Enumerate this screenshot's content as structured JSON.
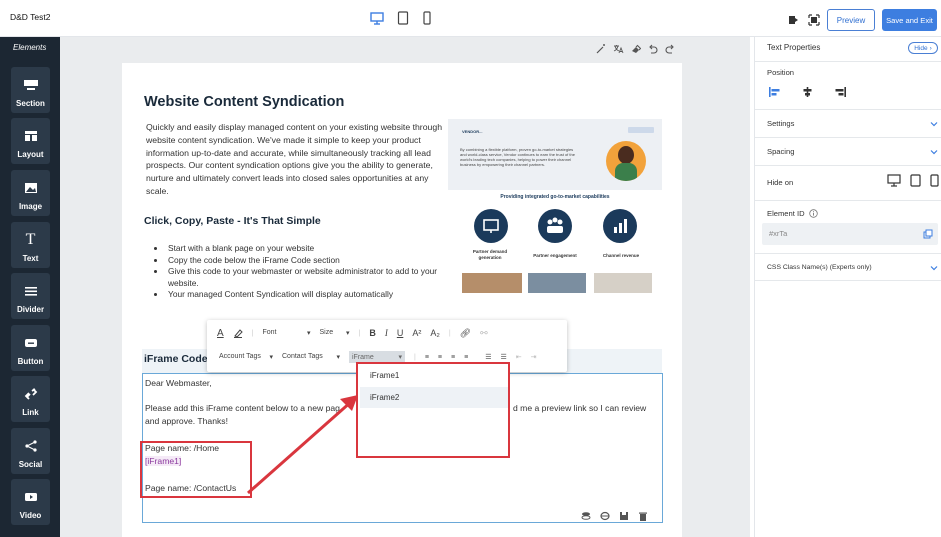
{
  "app": {
    "title": "D&D Test2",
    "preview_label": "Preview",
    "save_label": "Save and Exit"
  },
  "elements_panel": {
    "heading": "Elements",
    "items": [
      {
        "label": "Section",
        "icon": "section-icon"
      },
      {
        "label": "Layout",
        "icon": "layout-icon"
      },
      {
        "label": "Image",
        "icon": "image-icon"
      },
      {
        "label": "Text",
        "icon": "text-icon"
      },
      {
        "label": "Divider",
        "icon": "divider-icon"
      },
      {
        "label": "Button",
        "icon": "button-icon"
      },
      {
        "label": "Link",
        "icon": "link-icon"
      },
      {
        "label": "Social",
        "icon": "share-icon"
      },
      {
        "label": "Video",
        "icon": "video-icon"
      }
    ]
  },
  "content": {
    "heading": "Website Content Syndication",
    "paragraph": "Quickly and easily display managed content on your existing website through website content syndication. We've made it simple to keep your product information up-to-date and accurate, while simultaneously tracking all lead prospects. Our content syndication options give you the ability to generate, nurture and ultimately convert leads into closed sales opportunities at any scale.",
    "subheading": "Click, Copy, Paste - It's That Simple",
    "bullets": [
      "Start with a blank page on your website",
      "Copy the code below the iFrame Code section",
      "Give this code to your webmaster or website administrator to add to your website.",
      "Your managed Content Syndication will display automatically"
    ],
    "iframe_heading": "iFrame Code"
  },
  "promo": {
    "logo_text": "VENDOR...",
    "blurb": "By combining a flexible platform, proven go-to-market strategies and world-class service, Vendor continues to earn the trust of the world's leading tech companies, helping to power their channel business by empowering their channel partners.",
    "capabilities_title": "Providing integrated go-to-market capabilities",
    "capabilities": [
      "Partner demand generation",
      "Partner engagement",
      "Channel revenue"
    ]
  },
  "toolbar": {
    "font_label": "Font",
    "size_label": "Size",
    "account_tags_label": "Account Tags",
    "contact_tags_label": "Contact Tags",
    "iframe_select_label": "iFrame"
  },
  "editor": {
    "greeting": "Dear Webmaster,",
    "instruction_start": "Please add this iFrame content below to a new pag",
    "instruction_end": "d me a preview link so I can review",
    "instruction_line2": "and approve. Thanks!",
    "page1": "Page name: /Home",
    "token1": "[iFrame1]",
    "page2": "Page name: /ContactUs"
  },
  "dropdown": {
    "options": [
      "iFrame1",
      "iFrame2"
    ]
  },
  "properties": {
    "title": "Text Properties",
    "hide_label": "Hide",
    "position_label": "Position",
    "settings_label": "Settings",
    "spacing_label": "Spacing",
    "hide_on_label": "Hide on",
    "element_id_label": "Element ID",
    "element_id_value": "#xrTa",
    "css_class_label": "CSS Class Name(s) (Experts only)"
  },
  "colors": {
    "accent": "#3d7ee0",
    "sidebar": "#1c2733",
    "highlight": "#d9363e",
    "navy": "#1b3a5b"
  }
}
